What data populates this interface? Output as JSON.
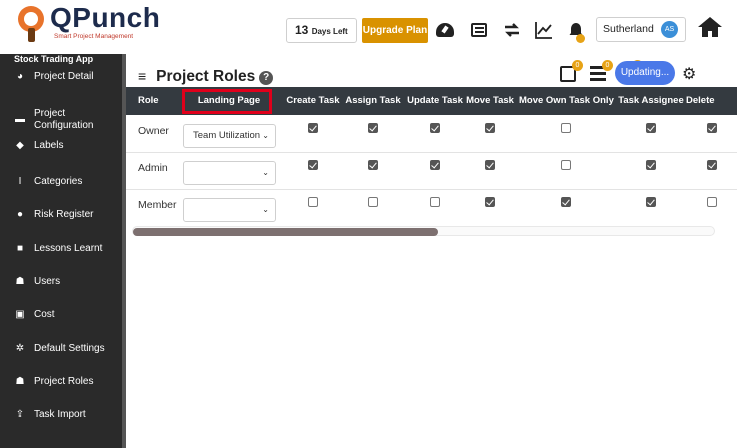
{
  "app": {
    "logo_title": "QPunch",
    "logo_subtitle": "Smart Project Management"
  },
  "topbar": {
    "days_left_number": "13",
    "days_left_text": "Days Left",
    "upgrade_label": "Upgrade Plan",
    "user_name": "Sutherland",
    "user_initials": "AS"
  },
  "sidebar": {
    "project_name": "Stock Trading App",
    "items": [
      {
        "label": "Project Detail",
        "icon": "dashboard-icon"
      },
      {
        "label": "Project Configuration",
        "icon": "list-icon"
      },
      {
        "label": "Labels",
        "icon": "tag-icon"
      },
      {
        "label": "Categories",
        "icon": "text-cursor-icon"
      },
      {
        "label": "Risk Register",
        "icon": "exclamation-icon"
      },
      {
        "label": "Lessons Learnt",
        "icon": "square-icon"
      },
      {
        "label": "Users",
        "icon": "users-icon"
      },
      {
        "label": "Cost",
        "icon": "money-icon"
      },
      {
        "label": "Default Settings",
        "icon": "cogs-icon"
      },
      {
        "label": "Project Roles",
        "icon": "users-icon"
      },
      {
        "label": "Task Import",
        "icon": "upload-icon"
      }
    ]
  },
  "main": {
    "title": "Project Roles",
    "tool_badges": [
      "0",
      "0",
      "0"
    ],
    "updating_label": "Updating...",
    "columns": [
      "Role",
      "Landing Page",
      "Create Task",
      "Assign Task",
      "Update Task",
      "Move Task",
      "Move Own Task Only",
      "Task Assignee",
      "Delete"
    ],
    "rows": [
      {
        "role": "Owner",
        "landing_page": "Team Utilization",
        "perms": [
          true,
          true,
          true,
          true,
          false,
          true,
          true
        ]
      },
      {
        "role": "Admin",
        "landing_page": "",
        "perms": [
          true,
          true,
          true,
          true,
          false,
          true,
          true
        ]
      },
      {
        "role": "Member",
        "landing_page": "",
        "perms": [
          false,
          false,
          false,
          true,
          true,
          true,
          false
        ]
      }
    ]
  },
  "colors": {
    "header_bg": "#343a40",
    "sidebar_bg": "#2a2a2a",
    "upgrade_bg": "#d99200",
    "highlight_border": "#e0001b",
    "updating_bg": "#4a78e8",
    "badge": "#e7a316"
  }
}
